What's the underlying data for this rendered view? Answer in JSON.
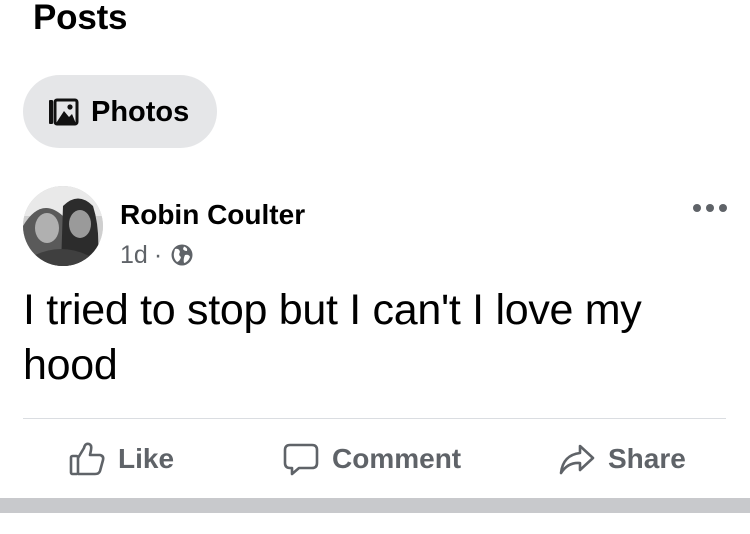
{
  "section": {
    "title": "Posts"
  },
  "filters": {
    "photos_label": "Photos"
  },
  "post": {
    "author": "Robin Coulter",
    "time": "1d",
    "separator": "·",
    "audience_icon": "globe-icon",
    "text": "I tried to stop but I can't I love my hood",
    "more_icon": "more-horizontal-icon"
  },
  "actions": {
    "like_label": "Like",
    "comment_label": "Comment",
    "share_label": "Share"
  },
  "colors": {
    "pill_bg": "#e5e6e8",
    "secondary_text": "#5f6368",
    "divider": "#dadde1",
    "band": "#c8c9cc"
  }
}
